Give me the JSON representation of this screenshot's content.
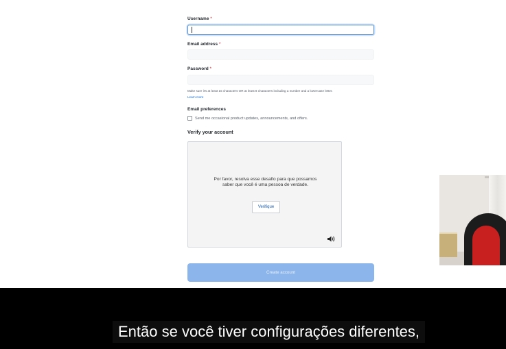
{
  "form": {
    "username": {
      "label": "Username",
      "required_mark": "*",
      "value": ""
    },
    "email": {
      "label": "Email address",
      "required_mark": "*",
      "value": ""
    },
    "password": {
      "label": "Password",
      "required_mark": "*",
      "value": "",
      "hint": "Make sure it's at least 15 characters OR at least 8 characters including a number and a lowercase letter.",
      "learn_more": "Learn more"
    },
    "email_preferences": {
      "label": "Email preferences",
      "checkbox_label": "Send me occasional product updates, announcements, and offers.",
      "checked": false
    },
    "verify": {
      "title": "Verify your account",
      "message": "Por favor, resolva esse desafio para que possamos saber que você é uma pessoa de verdade.",
      "button_label": "Verifique",
      "audio_icon": "speaker-icon"
    },
    "create_button_label": "Create account",
    "create_button_color": "#8cb5eb"
  },
  "caption": {
    "text": "Então se você tiver configurações diferentes,"
  }
}
